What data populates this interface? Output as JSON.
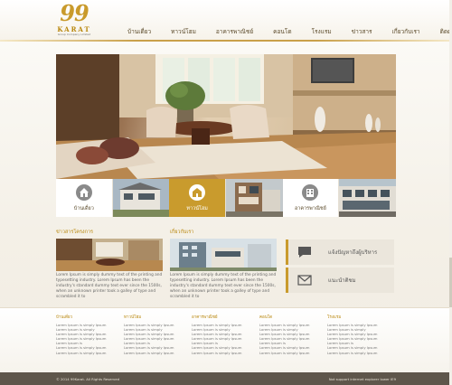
{
  "logo": {
    "number": "99",
    "word": "KARAT",
    "tagline": "Group Company Limited"
  },
  "nav": {
    "items": [
      "บ้านเดี่ยว",
      "ทาวน์โฮม",
      "อาคารพาณิชย์",
      "คอนโด",
      "โรงแรม",
      "ข่าวสาร",
      "เกี่ยวกับเรา",
      "ติดต่อเรา"
    ]
  },
  "categories": {
    "tiles": [
      {
        "kind": "icon",
        "label": "บ้านเดี่ยว",
        "icon": "house-icon",
        "active": false
      },
      {
        "kind": "photo"
      },
      {
        "kind": "icon",
        "label": "ทาวน์โฮม",
        "icon": "townhome-icon",
        "active": true
      },
      {
        "kind": "photo"
      },
      {
        "kind": "icon",
        "label": "อาคารพาณิชย์",
        "icon": "building-icon",
        "active": false
      },
      {
        "kind": "photo"
      }
    ]
  },
  "news": {
    "title": "ข่าวสารโครงการ",
    "text": "Lorem Ipsum is simply dummy text of the printing and typesetting industry. Lorem Ipsum has been the industry's standard dummy text ever since the 1500s, when an unknown printer took a galley of type and scrambled it to"
  },
  "about": {
    "title": "เกี่ยวกับเรา",
    "text": "Lorem Ipsum is simply dummy text of the printing and typesetting industry. Lorem Ipsum has been the industry's standard dummy text ever since the 1500s, when an unknown printer took a galley of type and scrambled it to"
  },
  "side_buttons": [
    {
      "label": "แจ้งปัญหาถึงผู้บริหาร",
      "icon": "chat-bubble-icon"
    },
    {
      "label": "แนะนำติชม",
      "icon": "mail-icon"
    }
  ],
  "footer": {
    "columns": [
      {
        "heading": "บ้านเดี่ยว",
        "links": [
          "Lorem Ipsum is simply Ipsum",
          "Lorem Ipsum is simply",
          "Lorem Ipsum is simply Ipsum",
          "Lorem Ipsum is simply Ipsum",
          "Lorem Ipsum is",
          "Lorem Ipsum is simply Ipsum",
          "Lorem Ipsum is simply Ipsum"
        ]
      },
      {
        "heading": "ทาวน์โฮม",
        "links": [
          "Lorem Ipsum is simply Ipsum",
          "Lorem Ipsum is simply",
          "Lorem Ipsum is simply Ipsum",
          "Lorem Ipsum is simply Ipsum",
          "Lorem Ipsum is",
          "Lorem Ipsum is simply Ipsum",
          "Lorem Ipsum is simply Ipsum"
        ]
      },
      {
        "heading": "อาคารพาณิชย์",
        "links": [
          "Lorem Ipsum is simply Ipsum",
          "Lorem Ipsum is simply",
          "Lorem Ipsum is simply Ipsum",
          "Lorem Ipsum is simply Ipsum",
          "Lorem Ipsum is",
          "Lorem Ipsum is simply Ipsum",
          "Lorem Ipsum is simply Ipsum"
        ]
      },
      {
        "heading": "คอนโด",
        "links": [
          "Lorem Ipsum is simply Ipsum",
          "Lorem Ipsum is simply",
          "Lorem Ipsum is simply Ipsum",
          "Lorem Ipsum is simply Ipsum",
          "Lorem Ipsum is",
          "Lorem Ipsum is simply Ipsum",
          "Lorem Ipsum is simply Ipsum"
        ]
      },
      {
        "heading": "โรงแรม",
        "links": [
          "Lorem Ipsum is simply Ipsum",
          "Lorem Ipsum is simply",
          "Lorem Ipsum is simply Ipsum",
          "Lorem Ipsum is simply Ipsum",
          "Lorem Ipsum is",
          "Lorem Ipsum is simply Ipsum",
          "Lorem Ipsum is simply Ipsum"
        ]
      }
    ],
    "copyright": "© 2014 99Karat. All Rights Reserved",
    "ie_note": "Not support internet explorer lower IE9"
  },
  "colors": {
    "gold": "#c99b2d",
    "footer_bar": "#5e564b"
  }
}
